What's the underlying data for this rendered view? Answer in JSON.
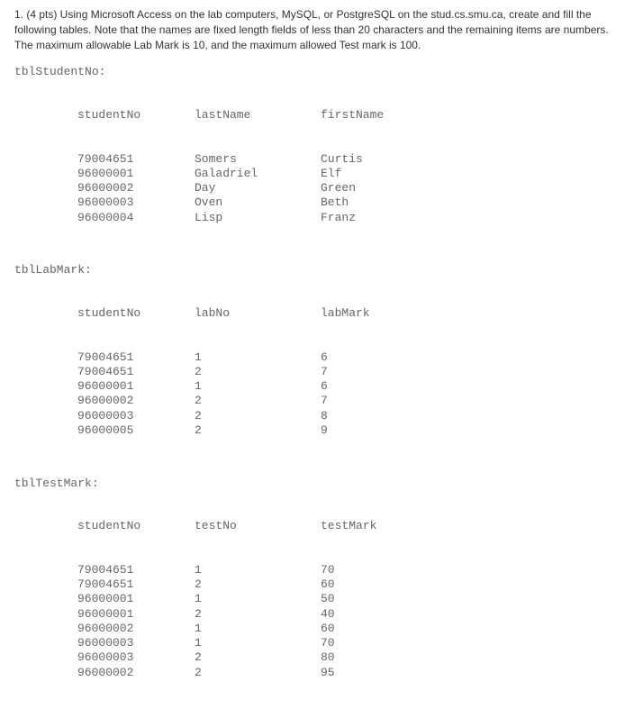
{
  "question": "1. (4 pts) Using Microsoft Access on the lab computers, MySQL, or PostgreSQL on the stud.cs.smu.ca, create and fill the following tables. Note that the names are fixed length fields of less than 20 characters and the remaining items are numbers. The maximum allowable Lab Mark is 10, and the maximum allowed Test mark is 100.",
  "tables": {
    "studentNo": {
      "title": "tblStudentNo:",
      "headers": [
        "studentNo",
        "lastName",
        "firstName"
      ],
      "rows": [
        [
          "79004651",
          "Somers",
          "Curtis"
        ],
        [
          "96000001",
          "Galadriel",
          "Elf"
        ],
        [
          "96000002",
          "Day",
          "Green"
        ],
        [
          "96000003",
          "Oven",
          "Beth"
        ],
        [
          "96000004",
          "Lisp",
          "Franz"
        ]
      ]
    },
    "labMark": {
      "title": "tblLabMark:",
      "headers": [
        "studentNo",
        "labNo",
        "labMark"
      ],
      "rows": [
        [
          "79004651",
          "1",
          "6"
        ],
        [
          "79004651",
          "2",
          "7"
        ],
        [
          "96000001",
          "1",
          "6"
        ],
        [
          "96000002",
          "2",
          "7"
        ],
        [
          "96000003",
          "2",
          "8"
        ],
        [
          "96000005",
          "2",
          "9"
        ]
      ]
    },
    "testMark": {
      "title": "tblTestMark:",
      "headers": [
        "studentNo",
        "testNo",
        "testMark"
      ],
      "rows": [
        [
          "79004651",
          "1",
          "70"
        ],
        [
          "79004651",
          "2",
          "60"
        ],
        [
          "96000001",
          "1",
          "50"
        ],
        [
          "96000001",
          "2",
          "40"
        ],
        [
          "96000002",
          "1",
          "60"
        ],
        [
          "96000003",
          "1",
          "70"
        ],
        [
          "96000003",
          "2",
          "80"
        ],
        [
          "96000002",
          "2",
          "95"
        ]
      ]
    }
  }
}
